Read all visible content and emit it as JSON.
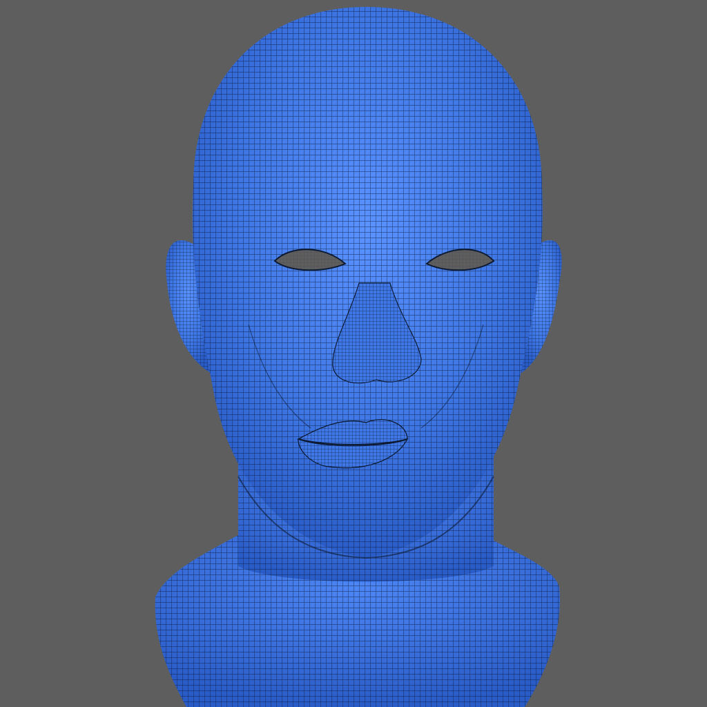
{
  "viewport": {
    "background_color": "#5e5e5e"
  },
  "model": {
    "subject": "wireframe-head-mesh",
    "surface_color": "#3f78e6",
    "highlight_color": "#5a93ff",
    "shadow_color": "#1f4fb3",
    "wire_color": "#0d1a33",
    "eye_hole_color": "#5e5e5e"
  }
}
